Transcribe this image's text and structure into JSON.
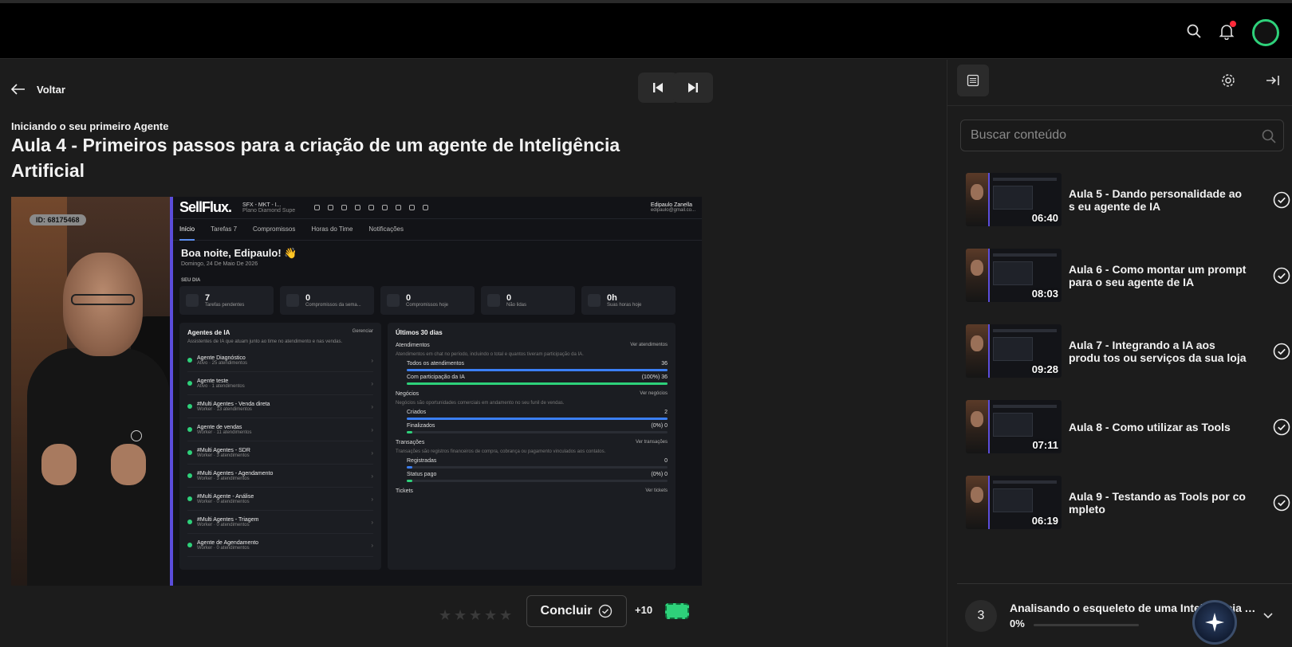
{
  "topbar": {
    "icons": [
      "search-icon",
      "bell-icon",
      "avatar"
    ],
    "colors": {
      "notification_dot": "#ff2a3a",
      "avatar_ring": "#2ed17a"
    }
  },
  "header": {
    "back_label": "Voltar",
    "module_name": "Iniciando o seu primeiro Agente",
    "lesson_title": "Aula 4 - Primeiros passos para a criação de um agente de Inteligência Artificial"
  },
  "video": {
    "id_badge": "ID: 68175468",
    "screen": {
      "logo": "SellFlux.",
      "workspace": "SFX - MKT - I...",
      "workspace_plan": "Plano Diamond Supe",
      "user_name": "Edipaulo Zanella",
      "user_email": "edipaulo@gmail.co...",
      "tabs": [
        "Início",
        "Tarefas 7",
        "Compromissos",
        "Horas do Time",
        "Notificações"
      ],
      "greeting": "Boa noite, Edipaulo! 👋",
      "date": "Domingo, 24 De Maio De 2026",
      "section_day": "SEU DIA",
      "stats": [
        {
          "value": "7",
          "label": "Tarefas pendentes"
        },
        {
          "value": "0",
          "label": "Compromissos da sema..."
        },
        {
          "value": "0",
          "label": "Compromissos hoje"
        },
        {
          "value": "0",
          "label": "Não lidas"
        },
        {
          "value": "0h",
          "label": "Suas horas hoje"
        }
      ],
      "agents_panel": {
        "title": "Agentes de IA",
        "action": "Gerenciar",
        "subtitle": "Assistentes de IA que atuam junto ao time no atendimento e nas vendas.",
        "agents": [
          {
            "name": "Agente Diagnóstico",
            "status": "Ativo · 25 atendimentos"
          },
          {
            "name": "Agente teste",
            "status": "Ativo · 1 atendimentos"
          },
          {
            "name": "#Multi Agentes - Venda direta",
            "status": "Worker · 13 atendimentos"
          },
          {
            "name": "Agente de vendas",
            "status": "Worker · 11 atendimentos"
          },
          {
            "name": "#Multi Agentes - SDR",
            "status": "Worker · 3 atendimentos"
          },
          {
            "name": "#Multi Agentes - Agendamento",
            "status": "Worker · 3 atendimentos"
          },
          {
            "name": "#Multi Agente - Análise",
            "status": "Worker · 0 atendimentos"
          },
          {
            "name": "#Multi Agentes - Triagem",
            "status": "Worker · 0 atendimentos"
          },
          {
            "name": "Agente de Agendamento",
            "status": "Worker · 0 atendimentos"
          }
        ]
      },
      "recent_panel": {
        "title": "Últimos 30 dias",
        "sections": [
          {
            "title": "Atendimentos",
            "action": "Ver atendimentos",
            "subtitle": "Atendimentos em chat no período, incluindo o total e quantos tiveram participação da IA.",
            "rows": [
              {
                "label": "Todos os atendimentos",
                "value": "36",
                "fill": 1.0,
                "color": "#3b7ff5"
              },
              {
                "label": "Com participação da IA",
                "value": "(100%) 36",
                "fill": 1.0,
                "color": "#2ed17a"
              }
            ]
          },
          {
            "title": "Negócios",
            "action": "Ver negócios",
            "subtitle": "Negócios são oportunidades comerciais em andamento no seu funil de vendas.",
            "rows": [
              {
                "label": "Criados",
                "value": "2",
                "fill": 1.0,
                "color": "#3b7ff5"
              },
              {
                "label": "Finalizados",
                "value": "(0%) 0",
                "fill": 0.02,
                "color": "#2ed17a"
              }
            ]
          },
          {
            "title": "Transações",
            "action": "Ver transações",
            "subtitle": "Transações são registros financeiros de compra, cobrança ou pagamento vinculados aos contatos.",
            "rows": [
              {
                "label": "Registradas",
                "value": "0",
                "fill": 0.02,
                "color": "#3b7ff5"
              },
              {
                "label": "Status pago",
                "value": "(0%) 0",
                "fill": 0.02,
                "color": "#2ed17a"
              }
            ]
          },
          {
            "title": "Tickets",
            "action": "Ver tickets",
            "subtitle": "",
            "rows": []
          }
        ]
      }
    }
  },
  "footer": {
    "rating_stars": 5,
    "rating_value": 0,
    "complete_label": "Concluir",
    "points": "+10"
  },
  "sidebar": {
    "search_placeholder": "Buscar conteúdo",
    "lessons": [
      {
        "title": "Aula 5 - Dando personalidade ao s eu agente de IA",
        "duration": "06:40",
        "completed": true
      },
      {
        "title": "Aula 6 - Como montar um prompt para o seu agente de IA",
        "duration": "08:03",
        "completed": true
      },
      {
        "title": "Aula 7 - Integrando a IA aos produ tos ou serviços da sua loja",
        "duration": "09:28",
        "completed": true
      },
      {
        "title": "Aula 8 - Como utilizar as Tools",
        "duration": "07:11",
        "completed": true
      },
      {
        "title": "Aula 9 - Testando as Tools por co mpleto",
        "duration": "06:19",
        "completed": true
      }
    ],
    "next_module": {
      "number": "3",
      "title": "Analisando o esqueleto de uma Inteligência Ar...",
      "progress_label": "0%",
      "progress": 0
    }
  }
}
